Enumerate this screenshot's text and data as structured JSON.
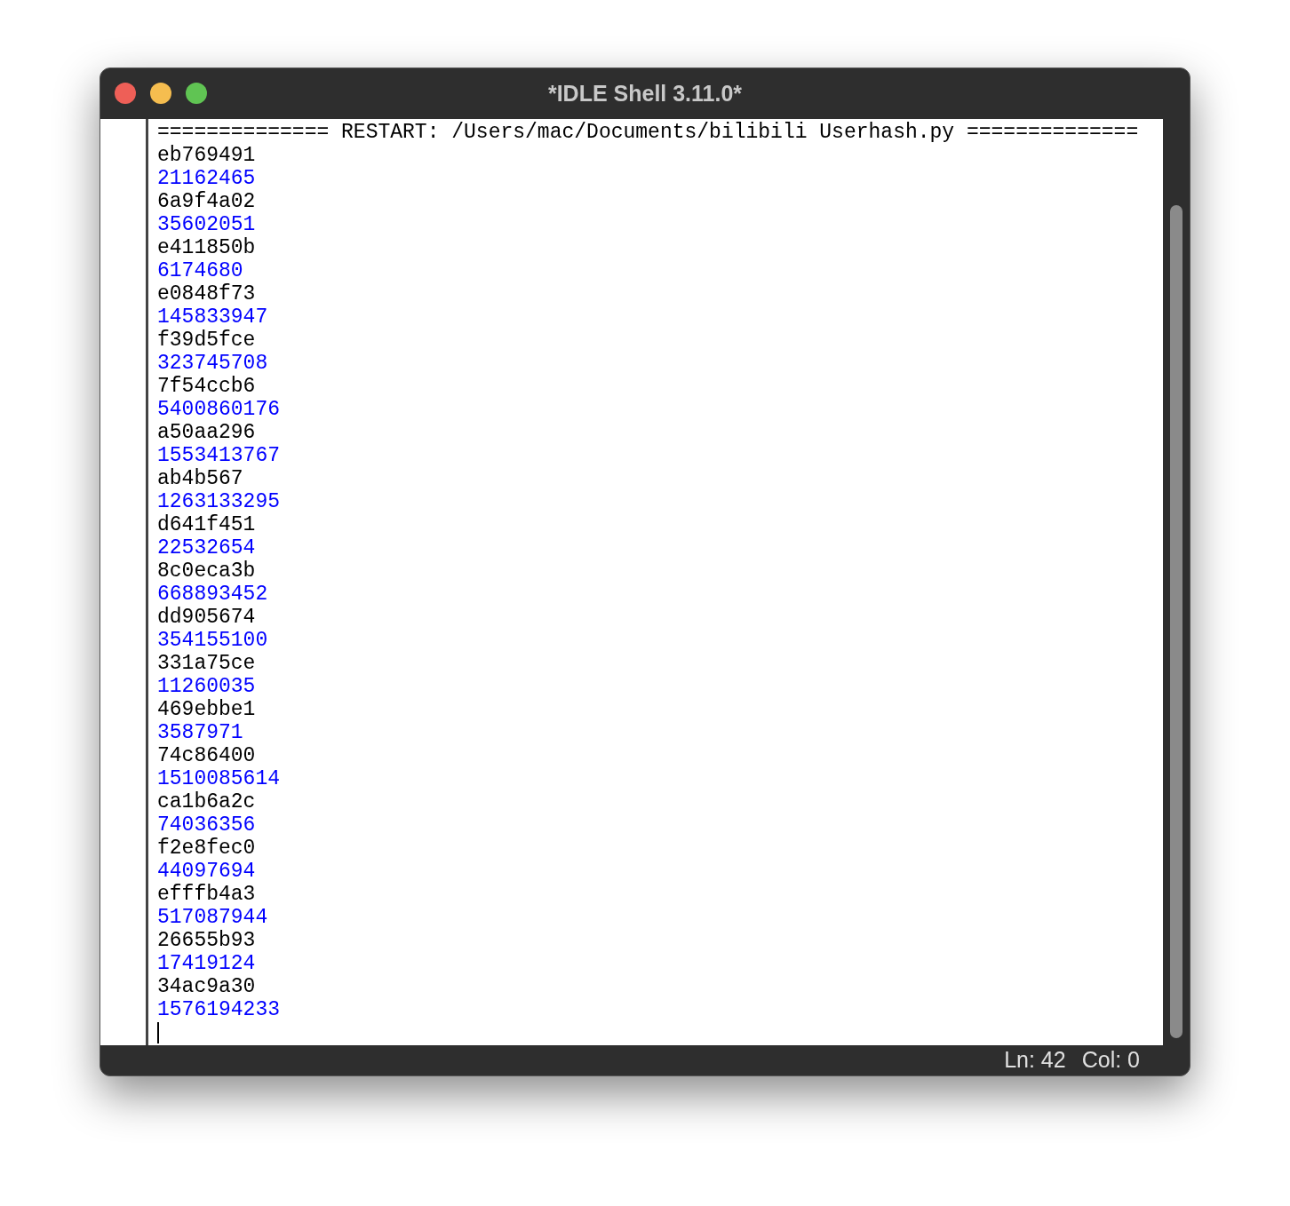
{
  "window": {
    "title": "*IDLE Shell 3.11.0*"
  },
  "shell": {
    "restart_line": "============== RESTART: /Users/mac/Documents/bilibili Userhash.py ==============",
    "lines": [
      {
        "text": "eb769491",
        "color": "#000000"
      },
      {
        "text": "21162465",
        "color": "#0000ff"
      },
      {
        "text": "6a9f4a02",
        "color": "#000000"
      },
      {
        "text": "35602051",
        "color": "#0000ff"
      },
      {
        "text": "e411850b",
        "color": "#000000"
      },
      {
        "text": "6174680",
        "color": "#0000ff"
      },
      {
        "text": "e0848f73",
        "color": "#000000"
      },
      {
        "text": "145833947",
        "color": "#0000ff"
      },
      {
        "text": "f39d5fce",
        "color": "#000000"
      },
      {
        "text": "323745708",
        "color": "#0000ff"
      },
      {
        "text": "7f54ccb6",
        "color": "#000000"
      },
      {
        "text": "5400860176",
        "color": "#0000ff"
      },
      {
        "text": "a50aa296",
        "color": "#000000"
      },
      {
        "text": "1553413767",
        "color": "#0000ff"
      },
      {
        "text": "ab4b567",
        "color": "#000000"
      },
      {
        "text": "1263133295",
        "color": "#0000ff"
      },
      {
        "text": "d641f451",
        "color": "#000000"
      },
      {
        "text": "22532654",
        "color": "#0000ff"
      },
      {
        "text": "8c0eca3b",
        "color": "#000000"
      },
      {
        "text": "668893452",
        "color": "#0000ff"
      },
      {
        "text": "dd905674",
        "color": "#000000"
      },
      {
        "text": "354155100",
        "color": "#0000ff"
      },
      {
        "text": "331a75ce",
        "color": "#000000"
      },
      {
        "text": "11260035",
        "color": "#0000ff"
      },
      {
        "text": "469ebbe1",
        "color": "#000000"
      },
      {
        "text": "3587971",
        "color": "#0000ff"
      },
      {
        "text": "74c86400",
        "color": "#000000"
      },
      {
        "text": "1510085614",
        "color": "#0000ff"
      },
      {
        "text": "ca1b6a2c",
        "color": "#000000"
      },
      {
        "text": "74036356",
        "color": "#0000ff"
      },
      {
        "text": "f2e8fec0",
        "color": "#000000"
      },
      {
        "text": "44097694",
        "color": "#0000ff"
      },
      {
        "text": "efffb4a3",
        "color": "#000000"
      },
      {
        "text": "517087944",
        "color": "#0000ff"
      },
      {
        "text": "26655b93",
        "color": "#000000"
      },
      {
        "text": "17419124",
        "color": "#0000ff"
      },
      {
        "text": "34ac9a30",
        "color": "#000000"
      },
      {
        "text": "1576194233",
        "color": "#0000ff"
      }
    ]
  },
  "status_bar": {
    "line": "Ln: 42",
    "column": "Col: 0"
  }
}
